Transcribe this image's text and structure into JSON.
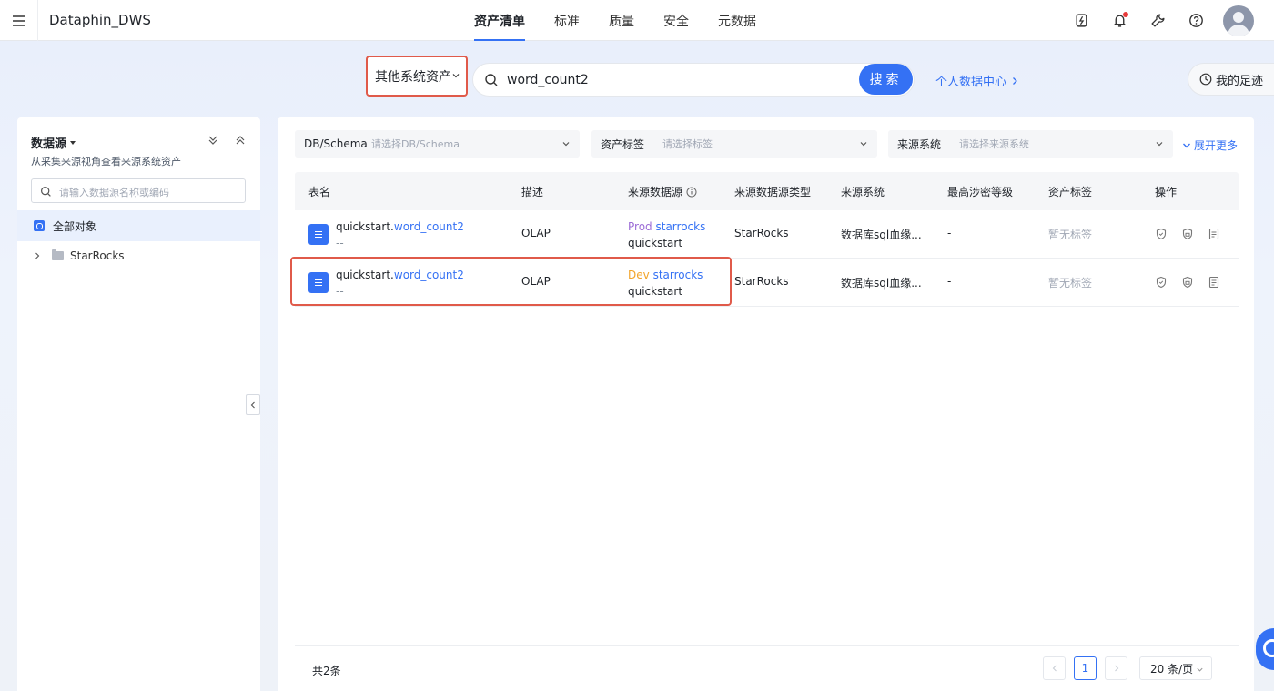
{
  "app": {
    "title": "Dataphin_DWS"
  },
  "nav": {
    "tabs": [
      {
        "label": "资产清单",
        "active": true
      },
      {
        "label": "标准",
        "active": false
      },
      {
        "label": "质量",
        "active": false
      },
      {
        "label": "安全",
        "active": false
      },
      {
        "label": "元数据",
        "active": false
      }
    ]
  },
  "header_icons": [
    "power-icon",
    "bell-icon",
    "wrench-icon",
    "help-icon",
    "avatar"
  ],
  "search": {
    "scope": "其他系统资产",
    "query": "word_count2",
    "button": "搜索",
    "personal_link": "个人数据中心",
    "footprint": "我的足迹"
  },
  "left_panel": {
    "title": "数据源",
    "subtitle": "从采集来源视角查看来源系统资产",
    "search_placeholder": "请输入数据源名称或编码",
    "all_objects": "全部对象",
    "tree": [
      {
        "label": "StarRocks"
      }
    ]
  },
  "filters": {
    "db_schema": {
      "label": "DB/Schema",
      "placeholder": "请选择DB/Schema"
    },
    "asset_tag": {
      "label": "资产标签",
      "placeholder": "请选择标签"
    },
    "source_system": {
      "label": "来源系统",
      "placeholder": "请选择来源系统"
    },
    "expand_more": "展开更多"
  },
  "table": {
    "headers": {
      "name": "表名",
      "desc": "描述",
      "source": "来源数据源",
      "source_type": "来源数据源类型",
      "source_system": "来源系统",
      "level": "最高涉密等级",
      "tags": "资产标签",
      "ops": "操作"
    },
    "rows": [
      {
        "name_prefix": "quickstart.",
        "name_hl": "word_count2",
        "sub": "--",
        "desc": "OLAP",
        "env": "Prod",
        "source_name": "starrocks",
        "source_db": "quickstart",
        "source_type": "StarRocks",
        "source_system": "数据库sql血缘...",
        "level": "-",
        "tags": "暂无标签"
      },
      {
        "name_prefix": "quickstart.",
        "name_hl": "word_count2",
        "sub": "--",
        "desc": "OLAP",
        "env": "Dev",
        "source_name": "starrocks",
        "source_db": "quickstart",
        "source_type": "StarRocks",
        "source_system": "数据库sql血缘...",
        "level": "-",
        "tags": "暂无标签"
      }
    ]
  },
  "pagination": {
    "total": "共2条",
    "current": "1",
    "page_size": "20 条/页"
  },
  "colors": {
    "accent": "#3471f4",
    "highlight": "#e05a4a",
    "prod": "#9b6bd6",
    "dev": "#f2a42b"
  }
}
